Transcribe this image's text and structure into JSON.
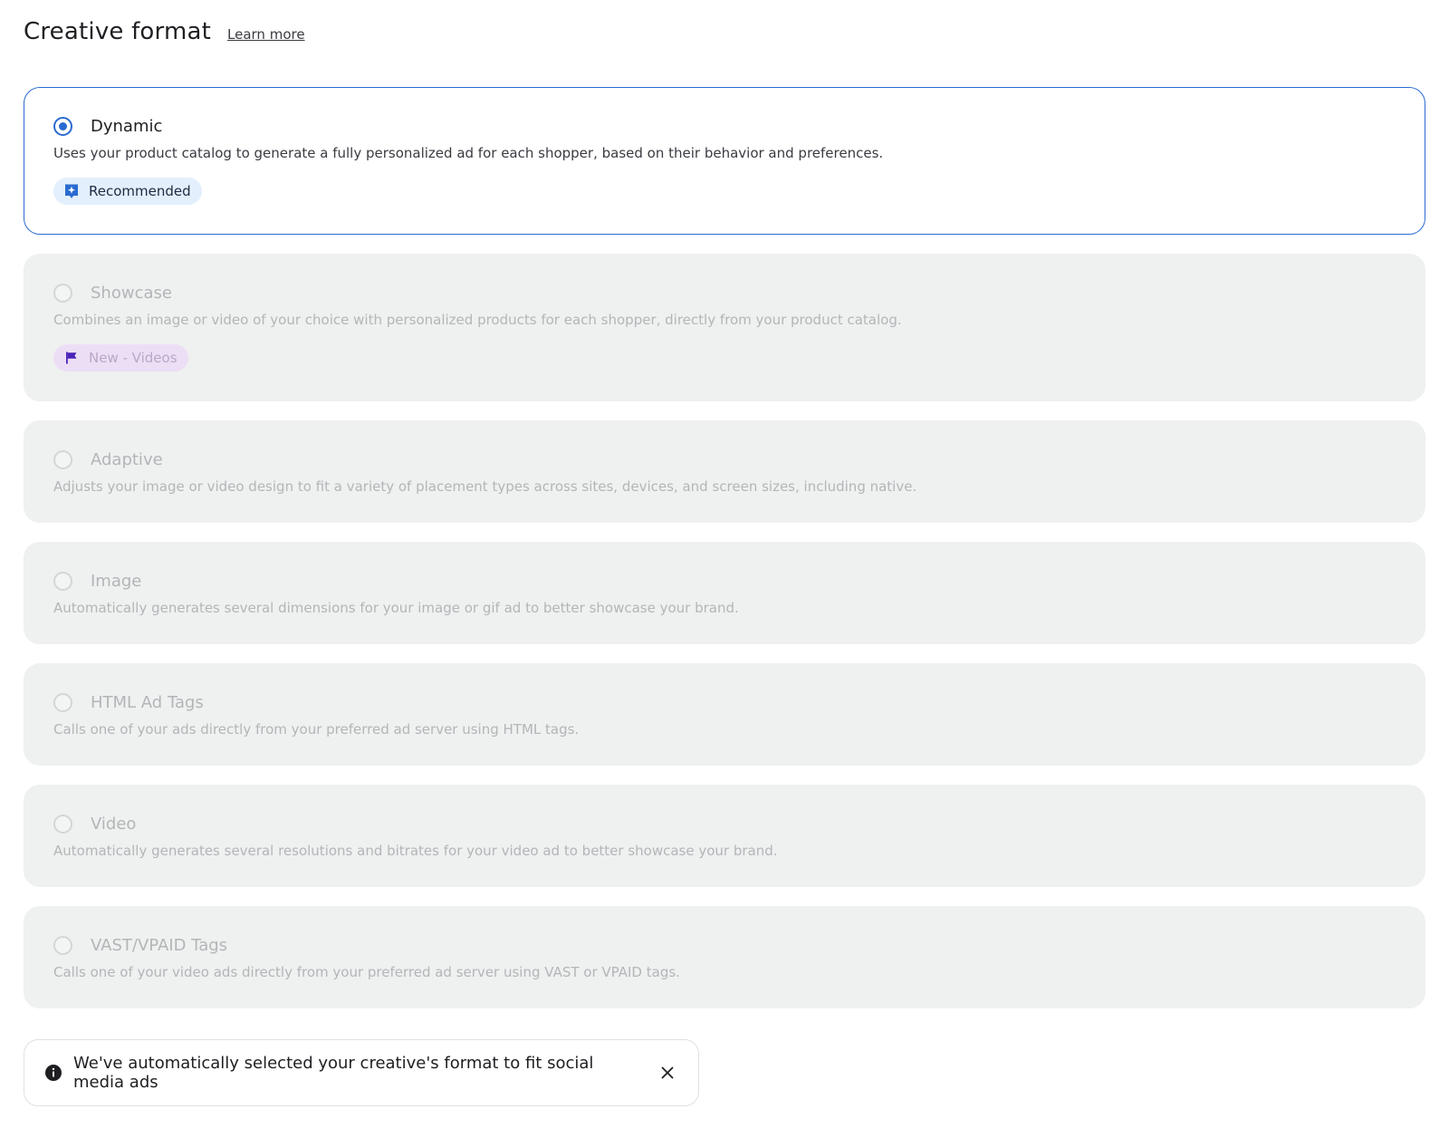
{
  "header": {
    "title": "Creative format",
    "learn_more": "Learn more"
  },
  "options": [
    {
      "title": "Dynamic",
      "description": "Uses your product catalog to generate a fully personalized ad for each shopper, based on their behavior and preferences.",
      "selected": true,
      "badge": {
        "label": "Recommended",
        "icon": "sparkle-badge-icon"
      }
    },
    {
      "title": "Showcase",
      "description": "Combines an image or video of your choice with personalized products for each shopper, directly from your product catalog.",
      "selected": false,
      "badge": {
        "label": "New - Videos",
        "icon": "flag-icon"
      }
    },
    {
      "title": "Adaptive",
      "description": "Adjusts your image or video design to fit a variety of placement types across sites, devices, and screen sizes, including native.",
      "selected": false
    },
    {
      "title": "Image",
      "description": "Automatically generates several dimensions for your image or gif ad to better showcase your brand.",
      "selected": false
    },
    {
      "title": "HTML Ad Tags",
      "description": "Calls one of your ads directly from your preferred ad server using HTML tags.",
      "selected": false
    },
    {
      "title": "Video",
      "description": "Automatically generates several resolutions and bitrates for your video ad to better showcase your brand.",
      "selected": false
    },
    {
      "title": "VAST/VPAID Tags",
      "description": "Calls one of your video ads directly from your preferred ad server using VAST or VPAID tags.",
      "selected": false
    }
  ],
  "toast": {
    "message": "We've automatically selected your creative's format to fit social media ads",
    "info_icon": "info-icon",
    "close_icon": "close-icon"
  },
  "colors": {
    "accent": "#2a6bd1",
    "disabled_card": "#eff0f0",
    "disabled_text": "#b4b5b8",
    "recommended_badge_bg": "#e3effc",
    "new_badge_bg": "#ecdff5",
    "flag_icon": "#4a23b8"
  }
}
